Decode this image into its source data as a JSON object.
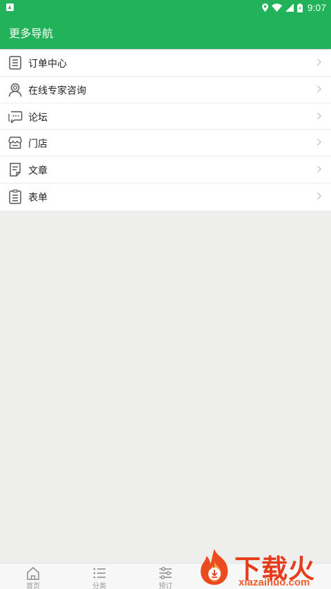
{
  "status_bar": {
    "time": "9:07"
  },
  "app_bar": {
    "title": "更多导航"
  },
  "menu": {
    "items": [
      {
        "label": "订单中心",
        "icon": "order-list-icon"
      },
      {
        "label": "在线专家咨询",
        "icon": "expert-user-icon"
      },
      {
        "label": "论坛",
        "icon": "chat-bubble-icon"
      },
      {
        "label": "门店",
        "icon": "store-icon"
      },
      {
        "label": "文章",
        "icon": "article-icon"
      },
      {
        "label": "表单",
        "icon": "form-clipboard-icon"
      }
    ]
  },
  "bottom_nav": {
    "tabs": [
      {
        "label": "首页",
        "icon": "home-icon"
      },
      {
        "label": "分类",
        "icon": "list-icon"
      },
      {
        "label": "预订",
        "icon": "sliders-icon"
      }
    ]
  },
  "watermark": {
    "main": "下载火",
    "sub": "xiazaihuo.com"
  },
  "colors": {
    "primary": "#21b25a",
    "background": "#eeeeec",
    "watermark": "#e63c1c"
  }
}
